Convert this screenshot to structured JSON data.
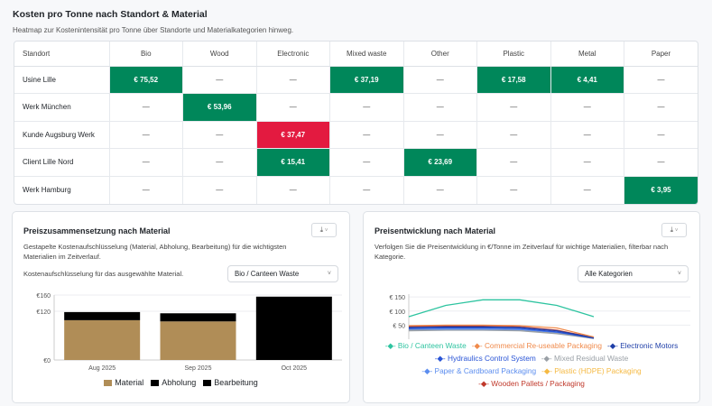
{
  "header": {
    "title": "Kosten pro Tonne nach Standort & Material",
    "subtitle": "Heatmap zur Kostenintensität pro Tonne über Standorte und Materialkategorien hinweg."
  },
  "heatmap": {
    "columns": [
      "Standort",
      "Bio",
      "Wood",
      "Electronic",
      "Mixed waste",
      "Other",
      "Plastic",
      "Metal",
      "Paper"
    ],
    "rows": [
      {
        "site": "Usine Lille",
        "cells": [
          "€ 75,52",
          "—",
          "—",
          "€ 37,19",
          "—",
          "€ 17,58",
          "€ 4,41",
          "—"
        ],
        "level": [
          "green",
          "",
          "",
          "green",
          "",
          "green",
          "green",
          ""
        ]
      },
      {
        "site": "Werk München",
        "cells": [
          "—",
          "€ 53,96",
          "—",
          "—",
          "—",
          "—",
          "—",
          "—"
        ],
        "level": [
          "",
          "green",
          "",
          "",
          "",
          "",
          "",
          ""
        ]
      },
      {
        "site": "Kunde Augsburg Werk",
        "cells": [
          "—",
          "—",
          "€ 37,47",
          "—",
          "—",
          "—",
          "—",
          "—"
        ],
        "level": [
          "",
          "",
          "red",
          "",
          "",
          "",
          "",
          ""
        ]
      },
      {
        "site": "Client Lille Nord",
        "cells": [
          "—",
          "—",
          "€ 15,41",
          "—",
          "€ 23,69",
          "—",
          "—",
          "—"
        ],
        "level": [
          "",
          "",
          "green",
          "",
          "green",
          "",
          "",
          ""
        ]
      },
      {
        "site": "Werk Hamburg",
        "cells": [
          "—",
          "—",
          "—",
          "—",
          "—",
          "—",
          "—",
          "€ 3,95"
        ],
        "level": [
          "",
          "",
          "",
          "",
          "",
          "",
          "",
          "green"
        ]
      }
    ],
    "colors": {
      "green": "#00875a",
      "red": "#e31a40"
    }
  },
  "left_card": {
    "title": "Preiszusammensetzung nach Material",
    "description": "Gestapelte Kostenaufschlüsselung (Material, Abholung, Bearbeitung) für die wichtigsten Materialien im Zeitverlauf.",
    "download_icon": "download-icon",
    "select_label": "Kostenaufschlüsselung für das ausgewählte Material.",
    "select_value": "Bio / Canteen Waste"
  },
  "right_card": {
    "title": "Preisentwicklung nach Material",
    "description": "Verfolgen Sie die Preisentwicklung in €/Tonne im Zeitverlauf für wichtige Materialien, filterbar nach Kategorie.",
    "download_icon": "download-icon",
    "select_value": "Alle Kategorien"
  },
  "chart_data": [
    {
      "type": "bar",
      "stacked": true,
      "categories": [
        "Aug 2025",
        "Sep 2025",
        "Oct 2025"
      ],
      "series": [
        {
          "name": "Material",
          "color": "#b08d57",
          "values": [
            98,
            95,
            0
          ]
        },
        {
          "name": "Abholung",
          "color": "#000000",
          "values": [
            20,
            20,
            156
          ]
        },
        {
          "name": "Bearbeitung",
          "color": "#000000",
          "values": [
            0,
            0,
            0
          ]
        }
      ],
      "yticks": [
        "€0",
        "€120",
        "€160"
      ],
      "ylim": [
        0,
        160
      ],
      "grid": true,
      "legend": "bottom"
    },
    {
      "type": "line",
      "x_count": 6,
      "yticks": [
        "€ 50",
        "€ 100",
        "€ 150"
      ],
      "ylim": [
        0,
        160
      ],
      "grid": true,
      "legend": "bottom",
      "series": [
        {
          "name": "Bio / Canteen Waste",
          "color": "#2ec4a0",
          "values": [
            80,
            120,
            140,
            140,
            120,
            80
          ]
        },
        {
          "name": "Commercial Re-useable Packaging",
          "color": "#f08a4b",
          "values": [
            48,
            50,
            50,
            48,
            40,
            8
          ]
        },
        {
          "name": "Electronic Motors",
          "color": "#1f3fa8",
          "values": [
            42,
            44,
            44,
            42,
            30,
            5
          ]
        },
        {
          "name": "Hydraulics Control System",
          "color": "#2a55d6",
          "values": [
            38,
            40,
            40,
            38,
            26,
            4
          ]
        },
        {
          "name": "Mixed Residual Waste",
          "color": "#9aa0a6",
          "values": [
            30,
            32,
            32,
            30,
            20,
            3
          ]
        },
        {
          "name": "Paper & Cardboard Packaging",
          "color": "#5b8def",
          "values": [
            35,
            36,
            36,
            34,
            24,
            4
          ]
        },
        {
          "name": "Plastic (HDPE) Packaging",
          "color": "#f5b942",
          "values": [
            33,
            34,
            34,
            32,
            22,
            3
          ]
        },
        {
          "name": "Wooden Pallets / Packaging",
          "color": "#c0392b",
          "values": [
            45,
            46,
            46,
            44,
            32,
            6
          ]
        }
      ]
    }
  ]
}
